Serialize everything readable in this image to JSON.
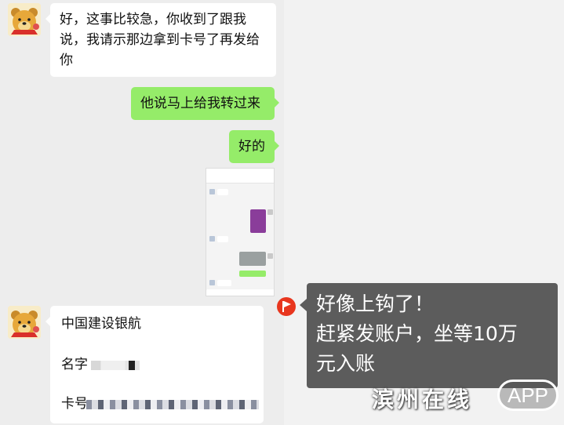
{
  "messages": [
    {
      "side": "in",
      "text": "好，这事比较急，你收到了跟我说，我请示那边拿到卡号了再发给你"
    },
    {
      "side": "out",
      "text": "他说马上给我转过来"
    },
    {
      "side": "out",
      "text": "好的"
    }
  ],
  "bank_card": {
    "bank_name": "中国建设银航",
    "name_label": "名字",
    "card_label": "卡号"
  },
  "annotation": {
    "line1": "好像上钩了！",
    "line2": "赶紧发账户，坐等10万",
    "line3": "元入账"
  },
  "watermark": {
    "text": "滨州在线",
    "app": "APP"
  },
  "colors": {
    "chat_bg": "#ededed",
    "outgoing_bubble": "#95ec69",
    "incoming_bubble": "#ffffff",
    "annotation_bg": "#5c5c5c",
    "flag": "#e8361e"
  }
}
